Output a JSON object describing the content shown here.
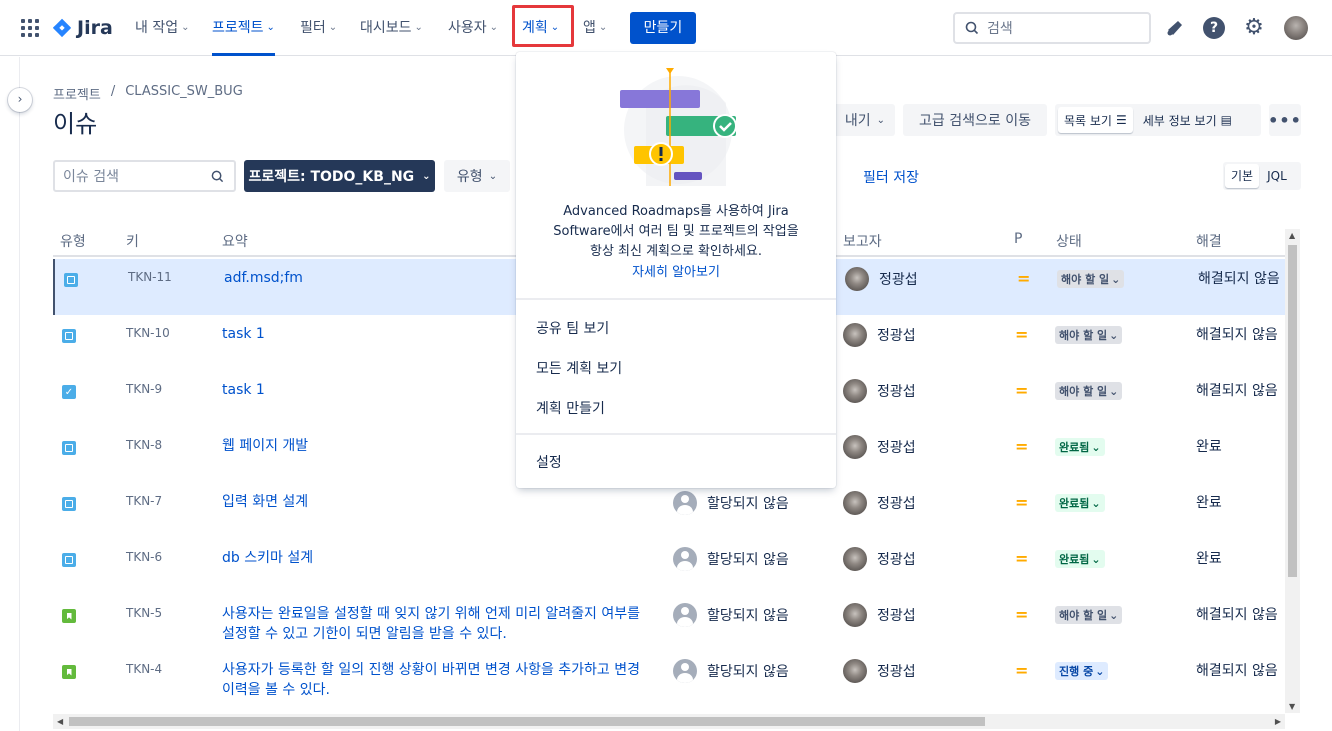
{
  "topnav": {
    "logo_text": "Jira",
    "items": [
      {
        "label": "내 작업"
      },
      {
        "label": "프로젝트"
      },
      {
        "label": "필터"
      },
      {
        "label": "대시보드"
      },
      {
        "label": "사용자"
      },
      {
        "label": "계획"
      },
      {
        "label": "앱"
      }
    ],
    "create_label": "만들기",
    "search_placeholder": "검색",
    "brand_color": "#0052cc"
  },
  "breadcrumb": {
    "root": "프로젝트",
    "separator": "/",
    "current": "CLASSIC_SW_BUG"
  },
  "page_title": "이슈",
  "toolbar": {
    "export_label": "내기",
    "advanced_search_label": "고급 검색으로 이동",
    "list_view_label": "목록 보기",
    "detail_view_label": "세부 정보 보기",
    "more_label": "•••"
  },
  "filters": {
    "search_placeholder": "이슈 검색",
    "project_label": "프로젝트: TODO_KB_NG",
    "type_label": "유형",
    "save_filter_label": "필터 저장",
    "basic_label": "기본",
    "jql_label": "JQL"
  },
  "table": {
    "headers": {
      "type": "유형",
      "key": "키",
      "summary": "요약",
      "reporter": "보고자",
      "priority": "P",
      "status": "상태",
      "resolution": "해결"
    },
    "rows": [
      {
        "type": "task",
        "key": "TKN-11",
        "summary": "adf.msd;fm",
        "assignee": "",
        "reporter": "정광섭",
        "priority": "=",
        "status": "해야 할 일",
        "status_kind": "todo",
        "resolution": "해결되지 않음"
      },
      {
        "type": "task",
        "key": "TKN-10",
        "summary": "task 1",
        "assignee": "",
        "reporter": "정광섭",
        "priority": "=",
        "status": "해야 할 일",
        "status_kind": "todo",
        "resolution": "해결되지 않음"
      },
      {
        "type": "check",
        "key": "TKN-9",
        "summary": "task 1",
        "assignee": "",
        "reporter": "정광섭",
        "priority": "=",
        "status": "해야 할 일",
        "status_kind": "todo",
        "resolution": "해결되지 않음"
      },
      {
        "type": "task",
        "key": "TKN-8",
        "summary": "웹 페이지 개발",
        "assignee": "",
        "reporter": "정광섭",
        "priority": "=",
        "status": "완료됨",
        "status_kind": "done",
        "resolution": "완료"
      },
      {
        "type": "task",
        "key": "TKN-7",
        "summary": "입력 화면 설계",
        "assignee": "할당되지 않음",
        "reporter": "정광섭",
        "priority": "=",
        "status": "완료됨",
        "status_kind": "done",
        "resolution": "완료"
      },
      {
        "type": "task",
        "key": "TKN-6",
        "summary": "db 스키마 설계",
        "assignee": "할당되지 않음",
        "reporter": "정광섭",
        "priority": "=",
        "status": "완료됨",
        "status_kind": "done",
        "resolution": "완료"
      },
      {
        "type": "story",
        "key": "TKN-5",
        "summary": "사용자는 완료일을 설정할 때 잊지 않기 위해 언제 미리 알려줄지 여부를 설정할 수 있고 기한이 되면 알림을 받을 수 있다.",
        "assignee": "할당되지 않음",
        "reporter": "정광섭",
        "priority": "=",
        "status": "해야 할 일",
        "status_kind": "todo",
        "resolution": "해결되지 않음"
      },
      {
        "type": "story",
        "key": "TKN-4",
        "summary": "사용자가 등록한 할 일의 진행 상황이 바뀌면 변경 사항을 추가하고 변경 이력을 볼 수 있다.",
        "assignee": "할당되지 않음",
        "reporter": "정광섭",
        "priority": "=",
        "status": "진행 중",
        "status_kind": "prog",
        "resolution": "해결되지 않음"
      }
    ]
  },
  "plans_menu": {
    "promo_text": "Advanced Roadmaps를 사용하여 Jira Software에서 여러 팀 및 프로젝트의 작업을 항상 최신 계획으로 확인하세요.",
    "promo_link": "자세히 알아보기",
    "items": [
      {
        "label": "공유 팀 보기"
      },
      {
        "label": "모든 계획 보기"
      },
      {
        "label": "계획 만들기"
      }
    ],
    "settings_label": "설정"
  }
}
